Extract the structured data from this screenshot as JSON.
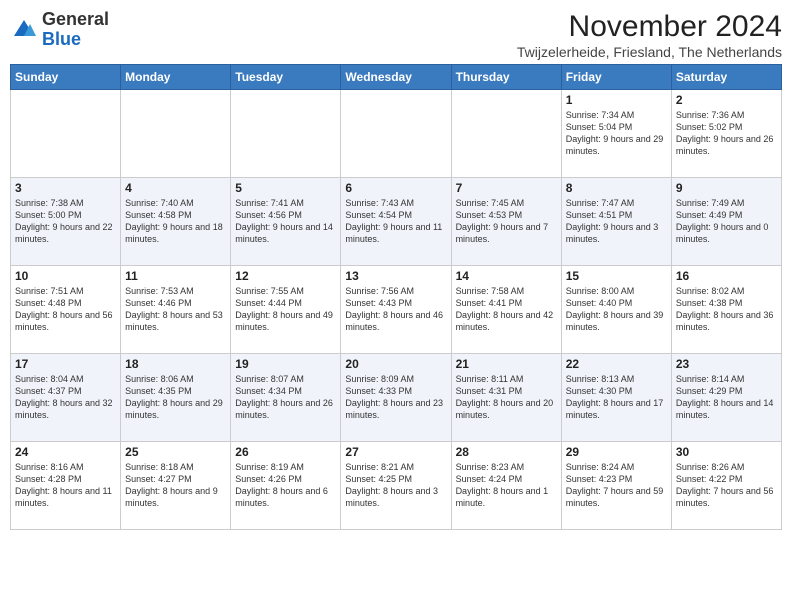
{
  "logo": {
    "general": "General",
    "blue": "Blue"
  },
  "header": {
    "title": "November 2024",
    "location": "Twijzelerheide, Friesland, The Netherlands"
  },
  "weekdays": [
    "Sunday",
    "Monday",
    "Tuesday",
    "Wednesday",
    "Thursday",
    "Friday",
    "Saturday"
  ],
  "weeks": [
    [
      {
        "day": "",
        "info": ""
      },
      {
        "day": "",
        "info": ""
      },
      {
        "day": "",
        "info": ""
      },
      {
        "day": "",
        "info": ""
      },
      {
        "day": "",
        "info": ""
      },
      {
        "day": "1",
        "info": "Sunrise: 7:34 AM\nSunset: 5:04 PM\nDaylight: 9 hours and 29 minutes."
      },
      {
        "day": "2",
        "info": "Sunrise: 7:36 AM\nSunset: 5:02 PM\nDaylight: 9 hours and 26 minutes."
      }
    ],
    [
      {
        "day": "3",
        "info": "Sunrise: 7:38 AM\nSunset: 5:00 PM\nDaylight: 9 hours and 22 minutes."
      },
      {
        "day": "4",
        "info": "Sunrise: 7:40 AM\nSunset: 4:58 PM\nDaylight: 9 hours and 18 minutes."
      },
      {
        "day": "5",
        "info": "Sunrise: 7:41 AM\nSunset: 4:56 PM\nDaylight: 9 hours and 14 minutes."
      },
      {
        "day": "6",
        "info": "Sunrise: 7:43 AM\nSunset: 4:54 PM\nDaylight: 9 hours and 11 minutes."
      },
      {
        "day": "7",
        "info": "Sunrise: 7:45 AM\nSunset: 4:53 PM\nDaylight: 9 hours and 7 minutes."
      },
      {
        "day": "8",
        "info": "Sunrise: 7:47 AM\nSunset: 4:51 PM\nDaylight: 9 hours and 3 minutes."
      },
      {
        "day": "9",
        "info": "Sunrise: 7:49 AM\nSunset: 4:49 PM\nDaylight: 9 hours and 0 minutes."
      }
    ],
    [
      {
        "day": "10",
        "info": "Sunrise: 7:51 AM\nSunset: 4:48 PM\nDaylight: 8 hours and 56 minutes."
      },
      {
        "day": "11",
        "info": "Sunrise: 7:53 AM\nSunset: 4:46 PM\nDaylight: 8 hours and 53 minutes."
      },
      {
        "day": "12",
        "info": "Sunrise: 7:55 AM\nSunset: 4:44 PM\nDaylight: 8 hours and 49 minutes."
      },
      {
        "day": "13",
        "info": "Sunrise: 7:56 AM\nSunset: 4:43 PM\nDaylight: 8 hours and 46 minutes."
      },
      {
        "day": "14",
        "info": "Sunrise: 7:58 AM\nSunset: 4:41 PM\nDaylight: 8 hours and 42 minutes."
      },
      {
        "day": "15",
        "info": "Sunrise: 8:00 AM\nSunset: 4:40 PM\nDaylight: 8 hours and 39 minutes."
      },
      {
        "day": "16",
        "info": "Sunrise: 8:02 AM\nSunset: 4:38 PM\nDaylight: 8 hours and 36 minutes."
      }
    ],
    [
      {
        "day": "17",
        "info": "Sunrise: 8:04 AM\nSunset: 4:37 PM\nDaylight: 8 hours and 32 minutes."
      },
      {
        "day": "18",
        "info": "Sunrise: 8:06 AM\nSunset: 4:35 PM\nDaylight: 8 hours and 29 minutes."
      },
      {
        "day": "19",
        "info": "Sunrise: 8:07 AM\nSunset: 4:34 PM\nDaylight: 8 hours and 26 minutes."
      },
      {
        "day": "20",
        "info": "Sunrise: 8:09 AM\nSunset: 4:33 PM\nDaylight: 8 hours and 23 minutes."
      },
      {
        "day": "21",
        "info": "Sunrise: 8:11 AM\nSunset: 4:31 PM\nDaylight: 8 hours and 20 minutes."
      },
      {
        "day": "22",
        "info": "Sunrise: 8:13 AM\nSunset: 4:30 PM\nDaylight: 8 hours and 17 minutes."
      },
      {
        "day": "23",
        "info": "Sunrise: 8:14 AM\nSunset: 4:29 PM\nDaylight: 8 hours and 14 minutes."
      }
    ],
    [
      {
        "day": "24",
        "info": "Sunrise: 8:16 AM\nSunset: 4:28 PM\nDaylight: 8 hours and 11 minutes."
      },
      {
        "day": "25",
        "info": "Sunrise: 8:18 AM\nSunset: 4:27 PM\nDaylight: 8 hours and 9 minutes."
      },
      {
        "day": "26",
        "info": "Sunrise: 8:19 AM\nSunset: 4:26 PM\nDaylight: 8 hours and 6 minutes."
      },
      {
        "day": "27",
        "info": "Sunrise: 8:21 AM\nSunset: 4:25 PM\nDaylight: 8 hours and 3 minutes."
      },
      {
        "day": "28",
        "info": "Sunrise: 8:23 AM\nSunset: 4:24 PM\nDaylight: 8 hours and 1 minute."
      },
      {
        "day": "29",
        "info": "Sunrise: 8:24 AM\nSunset: 4:23 PM\nDaylight: 7 hours and 59 minutes."
      },
      {
        "day": "30",
        "info": "Sunrise: 8:26 AM\nSunset: 4:22 PM\nDaylight: 7 hours and 56 minutes."
      }
    ]
  ]
}
